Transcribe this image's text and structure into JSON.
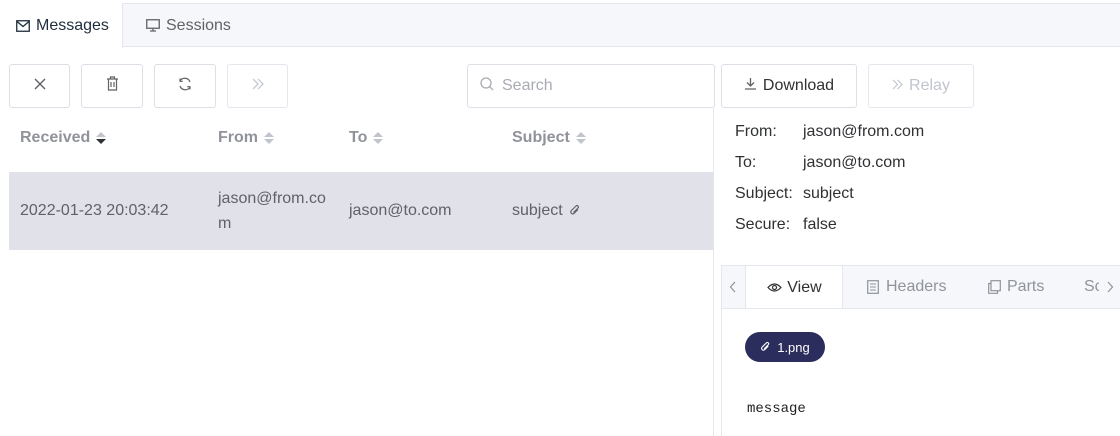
{
  "top_tabs": {
    "messages": "Messages",
    "sessions": "Sessions"
  },
  "toolbar": {
    "close_icon": "close-icon",
    "delete_icon": "trash-icon",
    "refresh_icon": "refresh-icon",
    "relay_icon": "double-chevron-right-icon",
    "search_placeholder": "Search",
    "download_label": "Download",
    "relay_label": "Relay"
  },
  "table": {
    "columns": [
      "Received",
      "From",
      "To",
      "Subject"
    ],
    "rows": [
      {
        "received": "2022-01-23 20:03:42",
        "from_line1": "jason@from.co",
        "from_line2": "m",
        "to": "jason@to.com",
        "subject": "subject"
      }
    ]
  },
  "detail": {
    "from_label": "From:",
    "from_value": "jason@from.com",
    "to_label": "To:",
    "to_value": "jason@to.com",
    "subject_label": "Subject:",
    "subject_value": "subject",
    "secure_label": "Secure:",
    "secure_value": "false"
  },
  "detail_tabs": [
    "View",
    "Headers",
    "Parts",
    "Sc"
  ],
  "attachment": {
    "name": "1.png"
  },
  "body_text": "message",
  "colors": {
    "selected_row": "#e0e1e9",
    "chip": "#2b2d5c"
  }
}
